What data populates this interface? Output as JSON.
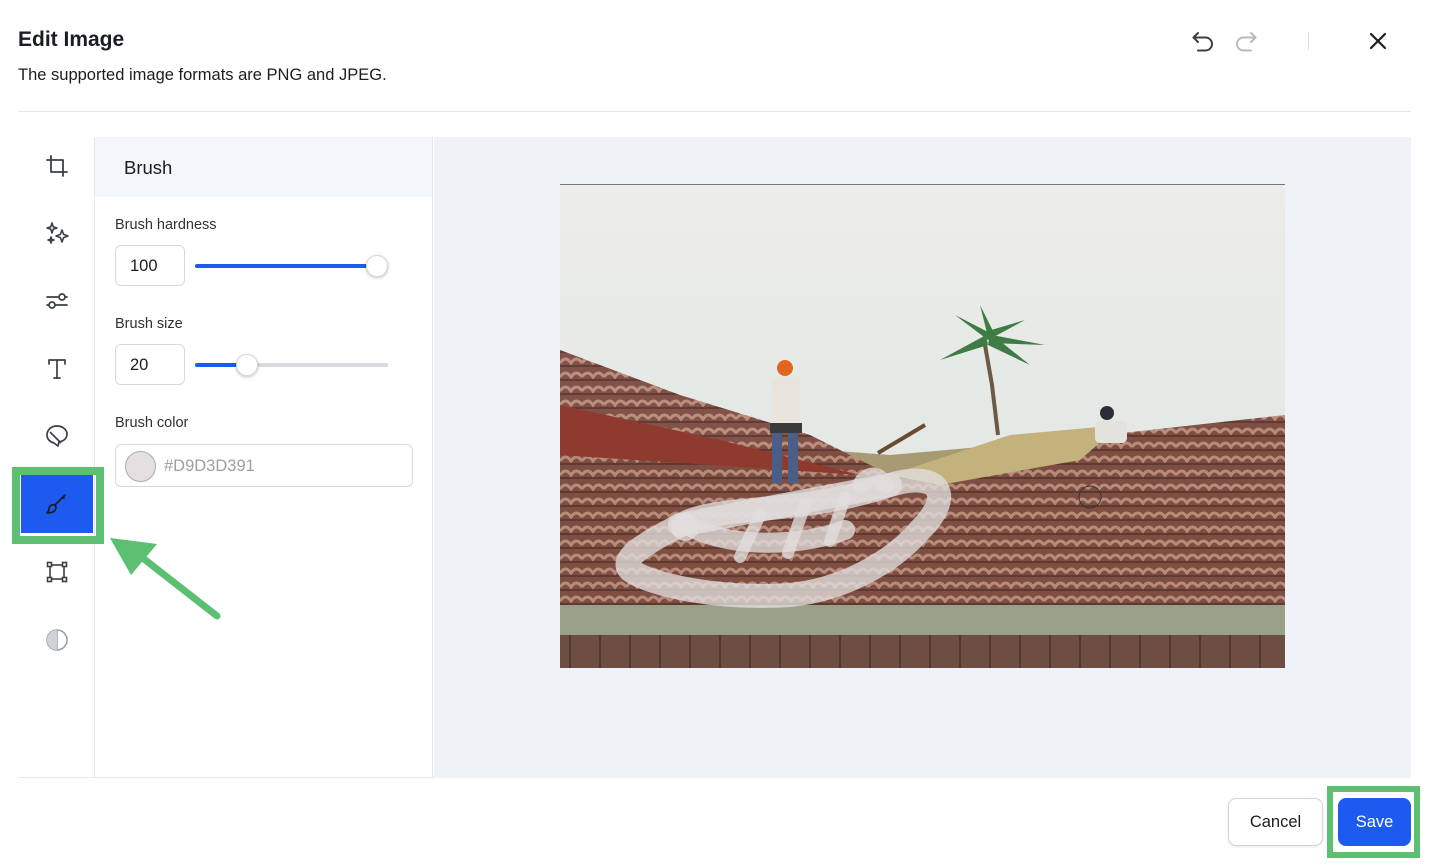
{
  "dialog": {
    "title": "Edit Image",
    "subtitle": "The supported image formats are PNG and JPEG."
  },
  "header_icons": [
    "undo-icon",
    "redo-icon",
    "close-icon"
  ],
  "toolbar": {
    "tools": [
      {
        "name": "crop",
        "icon": "crop-icon",
        "active": false
      },
      {
        "name": "filters",
        "icon": "sparkles-icon",
        "active": false
      },
      {
        "name": "adjust",
        "icon": "sliders-icon",
        "active": false
      },
      {
        "name": "text",
        "icon": "text-icon",
        "active": false
      },
      {
        "name": "shapes",
        "icon": "shapes-icon",
        "active": false
      },
      {
        "name": "brush",
        "icon": "brush-icon",
        "active": true
      },
      {
        "name": "resize",
        "icon": "resize-icon",
        "active": false
      },
      {
        "name": "contrast",
        "icon": "contrast-icon",
        "active": false
      }
    ]
  },
  "panel": {
    "title": "Brush",
    "hardness_label": "Brush hardness",
    "hardness_value": "100",
    "hardness_fraction": 1.0,
    "size_label": "Brush size",
    "size_value": "20",
    "size_fraction": 0.24,
    "color_label": "Brush color",
    "color_value": "#D9D3D391",
    "swatch_color": "#e5dfdf"
  },
  "footer": {
    "cancel_label": "Cancel",
    "save_label": "Save"
  },
  "colors": {
    "accent": "#1c5af0",
    "annotation_green": "#5cbf72"
  }
}
